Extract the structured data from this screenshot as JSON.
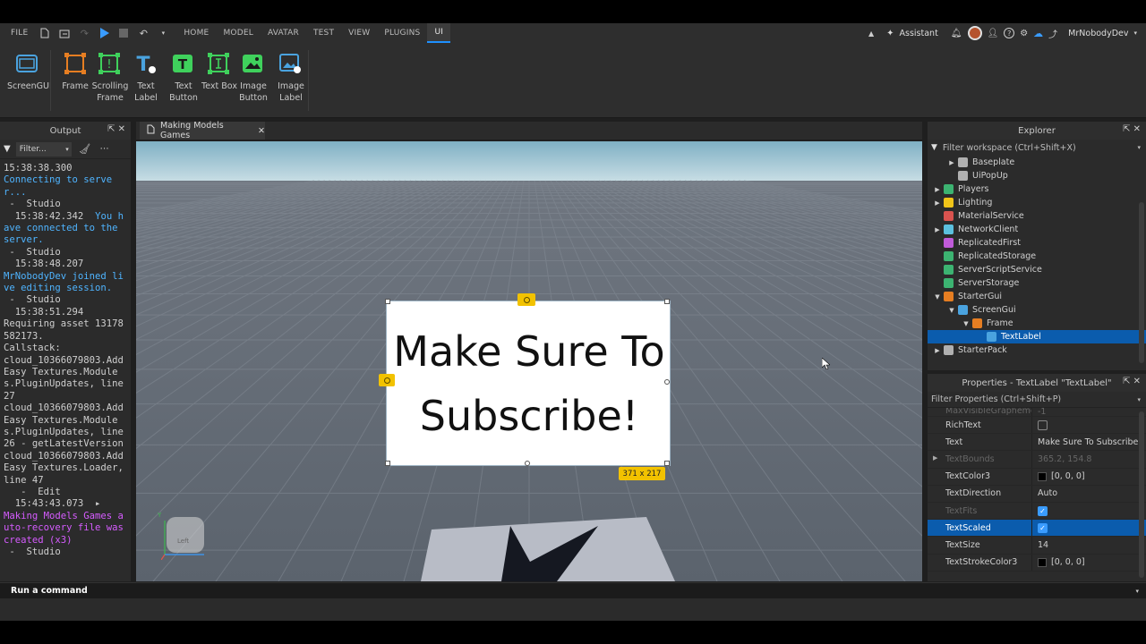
{
  "menu": {
    "file": "FILE",
    "tabs": [
      "HOME",
      "MODEL",
      "AVATAR",
      "TEST",
      "VIEW",
      "PLUGINS",
      "UI"
    ],
    "active_tab": "UI",
    "assistant": "Assistant",
    "username": "MrNobodyDev"
  },
  "ribbon": {
    "items": [
      {
        "label": "ScreenGUI",
        "icon": "screengui-icon"
      },
      {
        "label": "Frame",
        "icon": "frame-icon"
      },
      {
        "label": "Scrolling Frame",
        "icon": "scrolling-frame-icon"
      },
      {
        "label": "Text Label",
        "icon": "text-label-icon"
      },
      {
        "label": "Text Button",
        "icon": "text-button-icon"
      },
      {
        "label": "Text Box",
        "icon": "text-box-icon"
      },
      {
        "label": "Image Button",
        "icon": "image-button-icon"
      },
      {
        "label": "Image Label",
        "icon": "image-label-icon"
      }
    ]
  },
  "output": {
    "title": "Output",
    "filter_placeholder": "Filter...",
    "log": [
      {
        "t": "15:38:38.300",
        "c": "w",
        "indent": true
      },
      {
        "t": "Connecting to server...",
        "c": "b"
      },
      {
        "t": " -  Studio",
        "c": "w"
      },
      {
        "t": "  15:38:42.342 ",
        "c": "w"
      },
      {
        "t": " You have connected to the server.",
        "c": "b"
      },
      {
        "t": " -  Studio",
        "c": "w"
      },
      {
        "t": "  15:38:48.207",
        "c": "w"
      },
      {
        "t": "MrNobodyDev joined live editing session.",
        "c": "b"
      },
      {
        "t": " -  Studio",
        "c": "w"
      },
      {
        "t": "  15:38:51.294",
        "c": "w"
      },
      {
        "t": "Requiring asset 13178582173.",
        "c": "w"
      },
      {
        "t": "Callstack:",
        "c": "w"
      },
      {
        "t": "cloud_10366079803.AddEasy Textures.Modules.PluginUpdates, line 27",
        "c": "w"
      },
      {
        "t": "cloud_10366079803.AddEasy Textures.Modules.PluginUpdates, line 26 - getLatestVersion",
        "c": "w"
      },
      {
        "t": "cloud_10366079803.AddEasy Textures.Loader, line 47",
        "c": "w"
      },
      {
        "t": "   -  Edit",
        "c": "w"
      },
      {
        "t": "  15:43:43.073  ▸",
        "c": "w"
      },
      {
        "t": "Making Models Games auto-recovery file was created (x3)",
        "c": "p"
      },
      {
        "t": " -  Studio",
        "c": "w"
      }
    ]
  },
  "viewport": {
    "tab_label": "Making Models Games",
    "frame_text": "Make Sure To Subscribe!",
    "size_badge": "371 x 217",
    "view_cube_label": "Left"
  },
  "explorer": {
    "title": "Explorer",
    "filter_placeholder": "Filter workspace (Ctrl+Shift+X)",
    "items": [
      {
        "label": "Baseplate",
        "depth": 1,
        "arrow": "▶",
        "color": "#b0b0b0"
      },
      {
        "label": "UiPopUp",
        "depth": 1,
        "arrow": "",
        "color": "#b0b0b0"
      },
      {
        "label": "Players",
        "depth": 0,
        "arrow": "▶",
        "color": "#3cb371"
      },
      {
        "label": "Lighting",
        "depth": 0,
        "arrow": "▶",
        "color": "#f0c419"
      },
      {
        "label": "MaterialService",
        "depth": 0,
        "arrow": "",
        "color": "#d9534f"
      },
      {
        "label": "NetworkClient",
        "depth": 0,
        "arrow": "▶",
        "color": "#5bc0de"
      },
      {
        "label": "ReplicatedFirst",
        "depth": 0,
        "arrow": "",
        "color": "#c05bd9"
      },
      {
        "label": "ReplicatedStorage",
        "depth": 0,
        "arrow": "",
        "color": "#3cb371"
      },
      {
        "label": "ServerScriptService",
        "depth": 0,
        "arrow": "",
        "color": "#3cb371"
      },
      {
        "label": "ServerStorage",
        "depth": 0,
        "arrow": "",
        "color": "#3cb371"
      },
      {
        "label": "StarterGui",
        "depth": 0,
        "arrow": "▼",
        "color": "#e67e22"
      },
      {
        "label": "ScreenGui",
        "depth": 1,
        "arrow": "▼",
        "color": "#4aa3df"
      },
      {
        "label": "Frame",
        "depth": 2,
        "arrow": "▼",
        "color": "#e67e22"
      },
      {
        "label": "TextLabel",
        "depth": 3,
        "arrow": "",
        "color": "#4aa3df",
        "selected": true
      },
      {
        "label": "StarterPack",
        "depth": 0,
        "arrow": "▶",
        "color": "#b0b0b0"
      }
    ]
  },
  "properties": {
    "title": "Properties - TextLabel \"TextLabel\"",
    "filter_placeholder": "Filter Properties (Ctrl+Shift+P)",
    "rows": [
      {
        "name": "MaxVisibleGraphemes",
        "value": "-1",
        "dim": true,
        "partial": true
      },
      {
        "name": "RichText",
        "value": "",
        "type": "check",
        "checked": false
      },
      {
        "name": "Text",
        "value": "Make Sure To Subscribe!"
      },
      {
        "name": "TextBounds",
        "value": "365.2, 154.8",
        "dim": true,
        "arrow": true
      },
      {
        "name": "TextColor3",
        "value": "[0, 0, 0]",
        "type": "color"
      },
      {
        "name": "TextDirection",
        "value": "Auto"
      },
      {
        "name": "TextFits",
        "value": "",
        "type": "check",
        "checked": true,
        "dim": true
      },
      {
        "name": "TextScaled",
        "value": "",
        "type": "check",
        "checked": true,
        "selected": true
      },
      {
        "name": "TextSize",
        "value": "14"
      },
      {
        "name": "TextStrokeColor3",
        "value": "[0, 0, 0]",
        "type": "color"
      }
    ]
  },
  "command_bar": {
    "placeholder": "Run a command"
  }
}
